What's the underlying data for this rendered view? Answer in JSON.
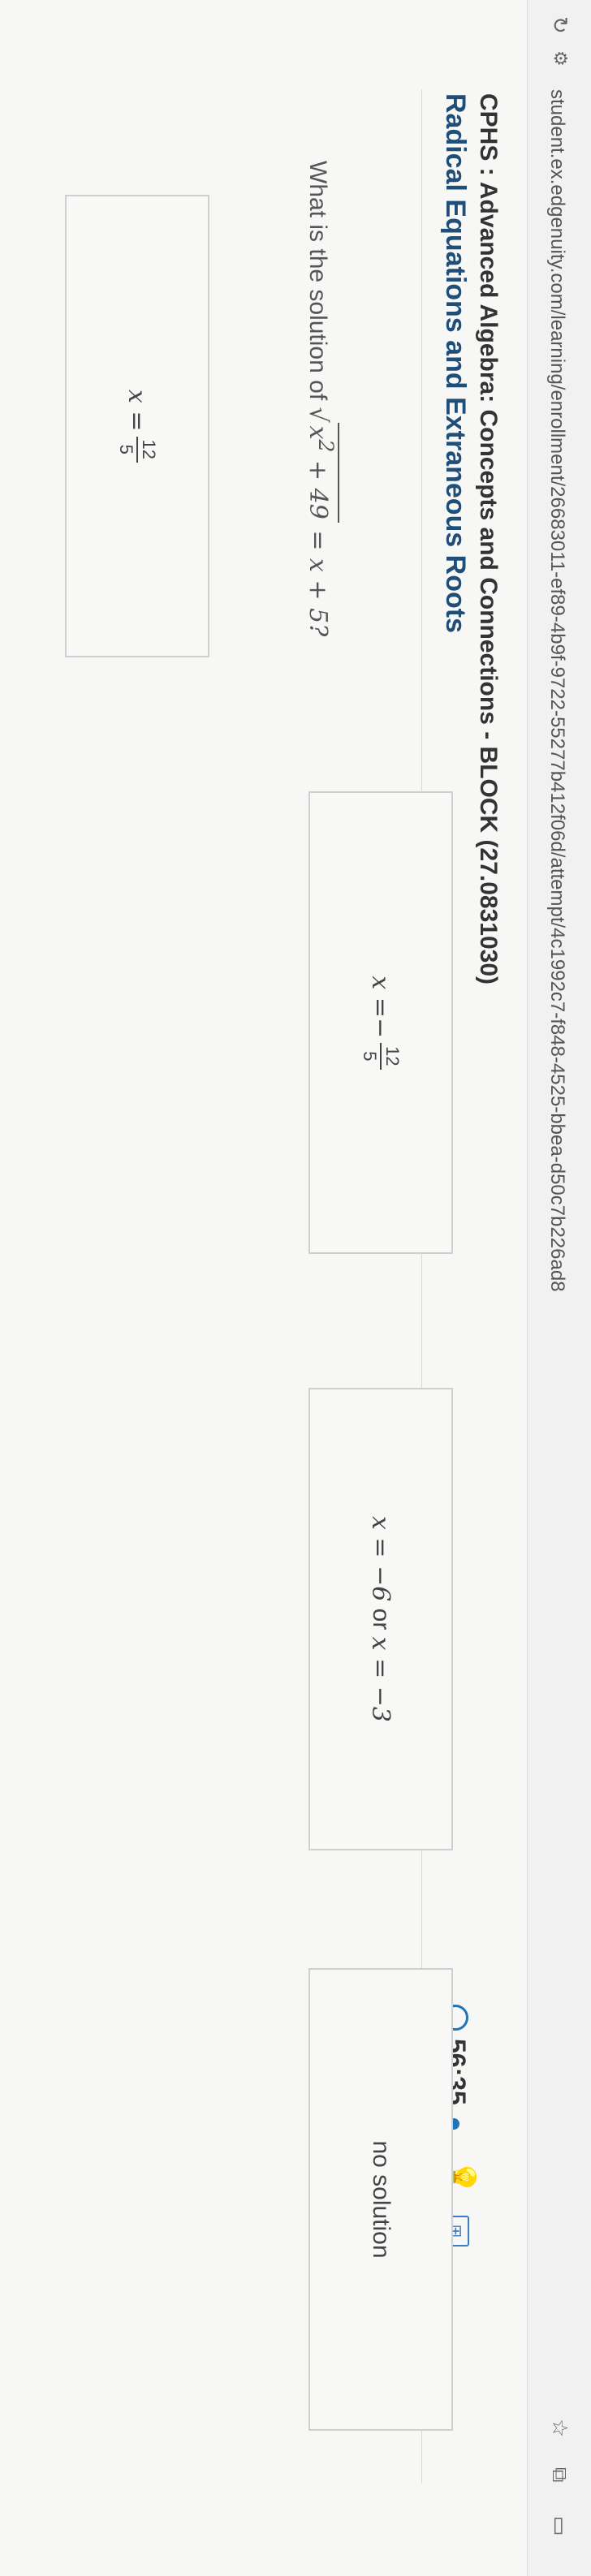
{
  "browser": {
    "url": "student.ex.edgenuity.com/learning/enrollment/26683011-ef89-4b9f-9722-55277b412f06d/attempt/4c1992c7-f848-4525-bbea-d50c7b226ad8",
    "icons": [
      "reload-icon",
      "site-info-icon",
      "star-icon",
      "extension-icon",
      "cast-icon",
      "sidebar-icon"
    ]
  },
  "header": {
    "course_title": "CPHS : Advanced Algebra: Concepts and Connections - BLOCK (27.0831030)",
    "lesson_title": "Radical Equations and Extraneous Roots",
    "timer": "56:35"
  },
  "question": {
    "prefix": "What is the solution of",
    "radicand": "x",
    "exponent": "2",
    "radicand_rest": " + 49",
    "rhs": " = x + 5?"
  },
  "answers": [
    {
      "lhs": "x = ",
      "sign": "",
      "num": "12",
      "den": "5"
    },
    {
      "lhs": "x = ",
      "sign": "−",
      "num": "12",
      "den": "5"
    },
    {
      "text_a": "x = −6",
      "or": " or ",
      "text_b": "x = −3"
    },
    {
      "text": "no solution"
    }
  ]
}
